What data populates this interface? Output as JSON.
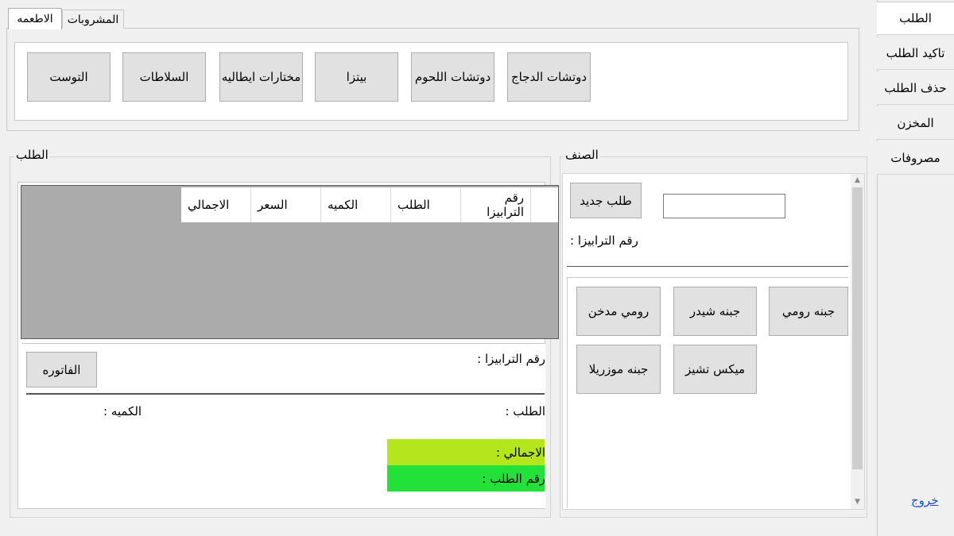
{
  "food_tabs": [
    {
      "label": "الاطعمه"
    },
    {
      "label": "المشروبات"
    }
  ],
  "categories": [
    {
      "label": "التوست"
    },
    {
      "label": "السلاطات"
    },
    {
      "label": "مختارات ايطاليه"
    },
    {
      "label": "بيتزا"
    },
    {
      "label": "دوتشات اللحوم"
    },
    {
      "label": "دوتشات الدجاج"
    }
  ],
  "sidebar": {
    "items": [
      {
        "label": "الطلب"
      },
      {
        "label": "تاكيد الطلب"
      },
      {
        "label": "حذف الطلب"
      },
      {
        "label": "المخزن"
      },
      {
        "label": "مصروفات"
      }
    ],
    "exit_label": "خروج"
  },
  "order_group": {
    "title": "الطلب",
    "columns": [
      "رقم الترابيزا",
      "الطلب",
      "الكميه",
      "السعر",
      "الاجمالي"
    ],
    "table_number_label": "رقم الترابيزا :",
    "invoice_button": "الفاتوره",
    "order_label": "الطلب :",
    "quantity_label": "الكميه :",
    "total_label": "الاجمالي :",
    "order_number_label": "رقم الطلب :"
  },
  "item_group": {
    "title": "الصنف",
    "new_order_button": "طلب جديد",
    "table_number_input": "",
    "table_number_label": "رقم الترابيزا :",
    "items": [
      {
        "label": "جبنه رومي"
      },
      {
        "label": "جبنه شيدر"
      },
      {
        "label": "رومي مدخن"
      },
      {
        "label": "ميكس تشيز"
      },
      {
        "label": "جبنه موزريلا"
      }
    ]
  },
  "colors": {
    "total_bg": "#b5e61d",
    "order_number_bg": "#22e23a",
    "grid_bg": "#ababab"
  }
}
